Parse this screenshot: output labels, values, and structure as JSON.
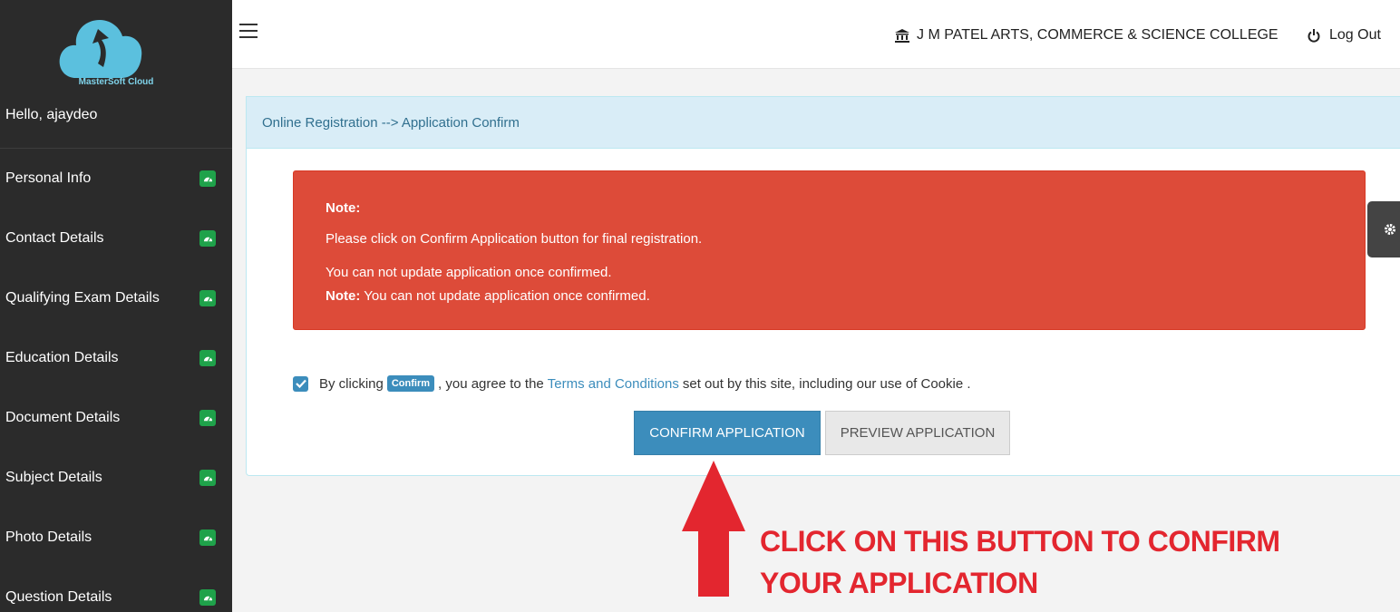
{
  "sidebar": {
    "logo_text": "MasterSoft Cloud",
    "greeting": "Hello, ajaydeo",
    "items": [
      {
        "label": "Personal Info"
      },
      {
        "label": "Contact Details"
      },
      {
        "label": "Qualifying Exam Details"
      },
      {
        "label": "Education Details"
      },
      {
        "label": "Document Details"
      },
      {
        "label": "Subject Details"
      },
      {
        "label": "Photo Details"
      },
      {
        "label": "Question Details"
      }
    ],
    "badge_icon": "dashboard-icon",
    "badge_color": "#1fa24a"
  },
  "topbar": {
    "college_name": "J M PATEL ARTS, COMMERCE & SCIENCE COLLEGE",
    "college_icon": "institution-icon",
    "logout_label": "Log Out",
    "logout_icon": "power-icon"
  },
  "panel": {
    "breadcrumb": "Online Registration --> Application Confirm"
  },
  "alert": {
    "heading": "Note:",
    "line1": "Please click on Confirm Application button for final registration.",
    "line2": "You can not update application once confirmed.",
    "line3_bold": "Note:",
    "line3_rest": " You can not update application once confirmed.",
    "color": "#dd4b39"
  },
  "agreement": {
    "checked": true,
    "prefix": "By clicking",
    "pill": "Confirm",
    "middle": ", you agree to the",
    "link": "Terms and Conditions",
    "suffix": "set out by this site, including our use of Cookie ."
  },
  "buttons": {
    "confirm": "CONFIRM APPLICATION",
    "preview": "PREVIEW APPLICATION",
    "accent": "#3c8dbc"
  },
  "annotation": {
    "line1": "CLICK ON THIS BUTTON TO CONFIRM",
    "line2": "YOUR APPLICATION",
    "color": "#e3262f"
  }
}
